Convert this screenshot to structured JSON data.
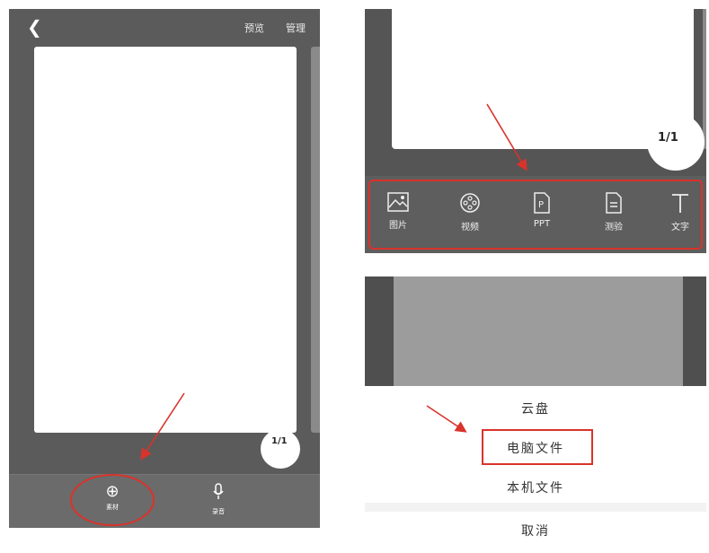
{
  "panel1": {
    "back_icon": "chevron-left-icon",
    "header": {
      "preview": "预览",
      "manage": "管理"
    },
    "page_indicator": "1/1",
    "toolbar": [
      {
        "icon": "plus-circle-icon",
        "label": "素材"
      },
      {
        "icon": "microphone-icon",
        "label": "录音"
      }
    ]
  },
  "panel2": {
    "page_indicator": "1/1",
    "toolbar": [
      {
        "icon": "image-icon",
        "label": "图片"
      },
      {
        "icon": "video-reel-icon",
        "label": "视频"
      },
      {
        "icon": "ppt-icon",
        "label": "PPT"
      },
      {
        "icon": "quiz-icon",
        "label": "测验"
      },
      {
        "icon": "text-icon",
        "label": "文字"
      }
    ]
  },
  "panel3": {
    "options": [
      "云盘",
      "电脑文件",
      "本机文件",
      "取消"
    ],
    "selected": "电脑文件"
  },
  "colors": {
    "highlight": "#d9332b",
    "panel_bg": "#5b5b5b"
  }
}
